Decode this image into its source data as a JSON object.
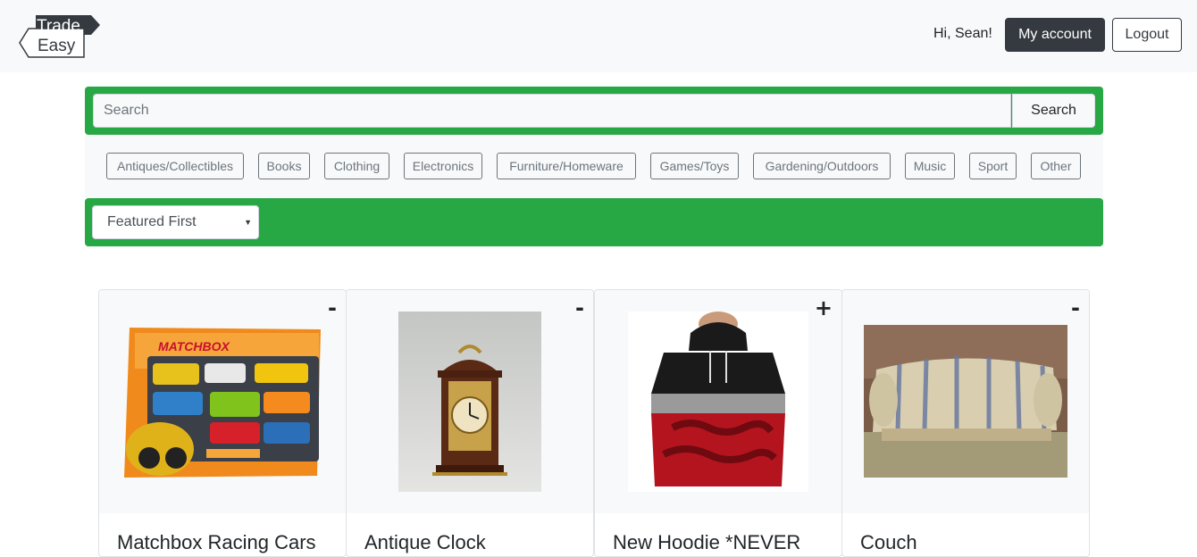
{
  "header": {
    "logo_text_line1": "Trade",
    "logo_text_line2": "Easy",
    "greeting": "Hi, Sean!",
    "my_account_label": "My account",
    "logout_label": "Logout"
  },
  "search": {
    "placeholder": "Search",
    "value": "",
    "button_label": "Search"
  },
  "categories": [
    "Antiques/Collectibles",
    "Books",
    "Clothing",
    "Electronics",
    "Furniture/Homeware",
    "Games/Toys",
    "Gardening/Outdoors",
    "Music",
    "Sport",
    "Other"
  ],
  "sort": {
    "selected": "Featured First"
  },
  "listings": [
    {
      "title": "Matchbox Racing Cars",
      "toggle": "-",
      "image": "matchbox-toy-box-image"
    },
    {
      "title": "Antique Clock",
      "toggle": "-",
      "image": "antique-clock-image"
    },
    {
      "title": "New Hoodie *NEVER",
      "toggle": "+",
      "image": "hoodie-image"
    },
    {
      "title": "Couch",
      "toggle": "-",
      "image": "couch-image"
    }
  ],
  "colors": {
    "brand_green": "#28a745",
    "dark_button": "#343a40",
    "light_bg": "#f8f9fa"
  }
}
